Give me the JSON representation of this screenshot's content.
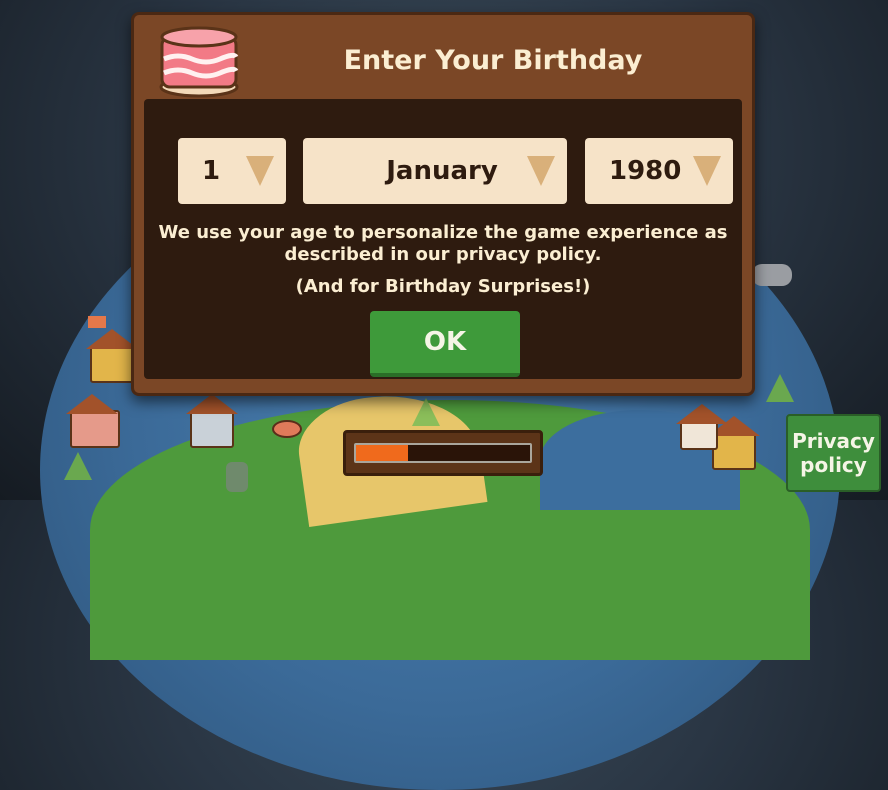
{
  "dialog": {
    "title": "Enter Your Birthday",
    "day": "1",
    "month": "January",
    "year": "1980",
    "description": "We use your age to personalize the game experience as described in our privacy policy.",
    "surprise_note": "(And for Birthday Surprises!)",
    "ok_label": "OK"
  },
  "loading": {
    "progress": 0.3
  },
  "privacy_button": {
    "label": "Privacy\npolicy"
  },
  "icons": {
    "dialog_icon": "cake-icon",
    "dropdown_icon": "triangle-down-icon"
  },
  "colors": {
    "panel": "#7b4726",
    "panel_inner": "#2e1b0f",
    "picker_bg": "#f6e3c8",
    "ok_green": "#3e9a3a",
    "progress_orange": "#f06a1c"
  }
}
